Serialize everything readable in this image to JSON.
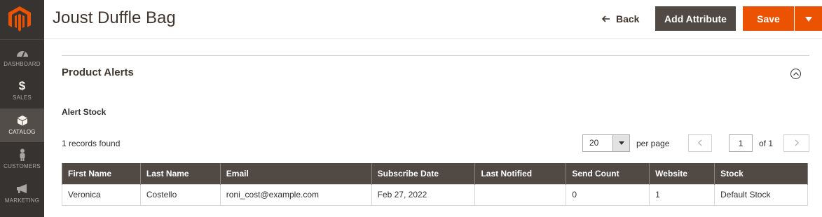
{
  "sidebar": {
    "items": [
      {
        "label": "DASHBOARD",
        "icon": "dashboard-icon"
      },
      {
        "label": "SALES",
        "icon": "dollar-icon"
      },
      {
        "label": "CATALOG",
        "icon": "box-icon",
        "active": true
      },
      {
        "label": "CUSTOMERS",
        "icon": "person-icon"
      },
      {
        "label": "MARKETING",
        "icon": "megaphone-icon"
      }
    ]
  },
  "header": {
    "title": "Joust Duffle Bag",
    "back_label": "Back",
    "add_attribute_label": "Add Attribute",
    "save_label": "Save"
  },
  "section": {
    "title": "Product Alerts",
    "subtitle": "Alert Stock"
  },
  "grid": {
    "records_found": "1 records found",
    "per_page_value": "20",
    "per_page_label": "per page",
    "current_page": "1",
    "page_of": "of 1",
    "columns": [
      "First Name",
      "Last Name",
      "Email",
      "Subscribe Date",
      "Last Notified",
      "Send Count",
      "Website",
      "Stock"
    ],
    "rows": [
      [
        "Veronica",
        "Costello",
        "roni_cost@example.com",
        "Feb 27, 2022",
        "",
        "0",
        "1",
        "Default Stock"
      ]
    ]
  },
  "colors": {
    "sidebar_bg": "#373330",
    "accent": "#eb5202",
    "dark_button": "#514943"
  }
}
